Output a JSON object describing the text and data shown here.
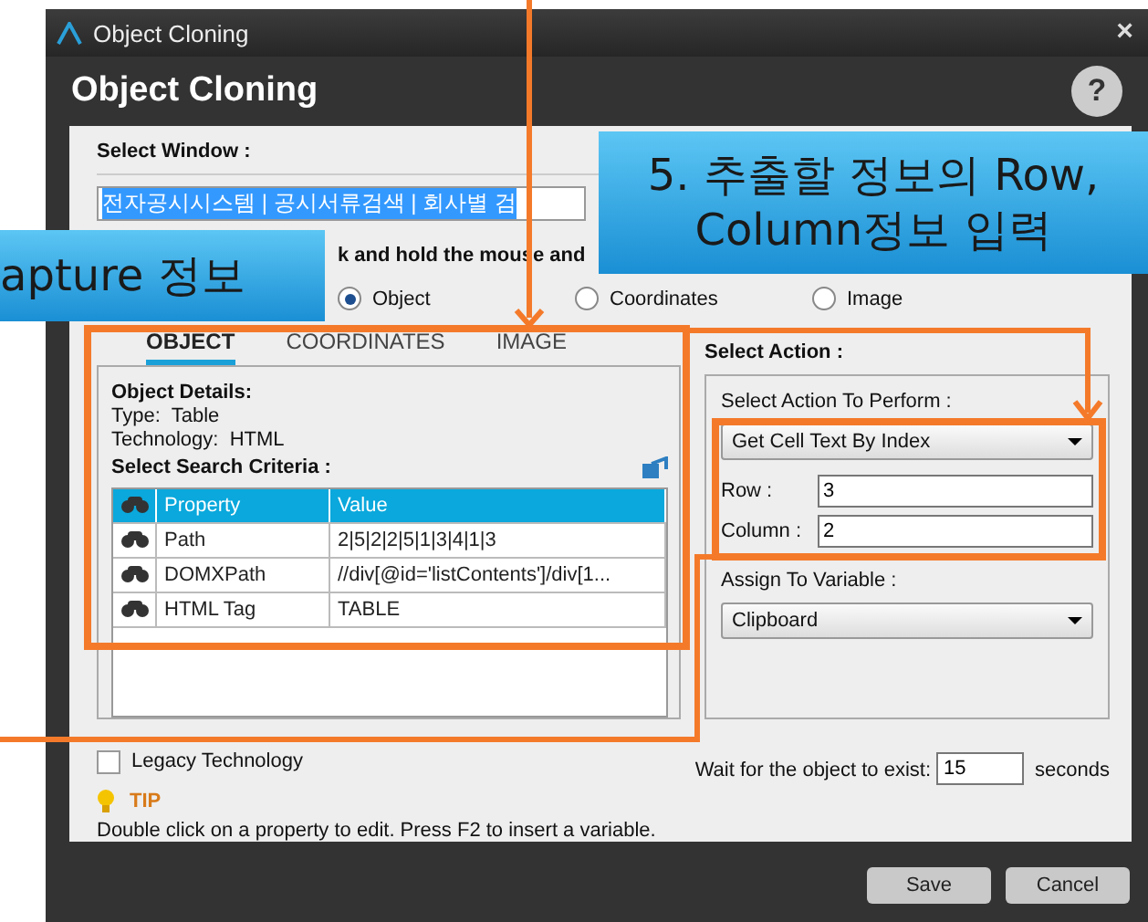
{
  "window": {
    "title": "Object Cloning",
    "close": "×"
  },
  "header": {
    "title": "Object Cloning",
    "help": "?"
  },
  "select_window": {
    "label": "Select Window :",
    "value": "전자공시시스템 | 공시서류검색 | 회사별 검"
  },
  "instruction": "k and hold the mouse and",
  "capture_modes": [
    {
      "label": "Object",
      "selected": true
    },
    {
      "label": "Coordinates",
      "selected": false
    },
    {
      "label": "Image",
      "selected": false
    }
  ],
  "tabs": [
    {
      "label": "OBJECT",
      "selected": true
    },
    {
      "label": "COORDINATES",
      "selected": false
    },
    {
      "label": "IMAGE",
      "selected": false
    }
  ],
  "object_details": {
    "heading": "Object Details:",
    "type_label": "Type:",
    "type": "Table",
    "technology_label": "Technology:",
    "technology": "HTML"
  },
  "search_criteria": {
    "heading": "Select Search Criteria :",
    "columns": [
      "Property",
      "Value"
    ],
    "rows": [
      {
        "property": "Path",
        "value": "2|5|2|2|5|1|3|4|1|3"
      },
      {
        "property": "DOMXPath",
        "value": "//div[@id='listContents']/div[1..."
      },
      {
        "property": "HTML Tag",
        "value": "TABLE"
      }
    ]
  },
  "action": {
    "heading": "Select Action :",
    "perform_label": "Select Action To Perform :",
    "perform_value": "Get Cell Text By Index",
    "row_label": "Row :",
    "row": "3",
    "column_label": "Column :",
    "column": "2",
    "assign_label": "Assign To Variable :",
    "assign_value": "Clipboard"
  },
  "legacy": {
    "label": "Legacy Technology",
    "checked": false
  },
  "wait": {
    "label": "Wait for the object to exist:",
    "value": "15",
    "unit": "seconds"
  },
  "tip": {
    "title": "TIP",
    "text": "Double click on a property to edit. Press F2 to insert a variable."
  },
  "buttons": [
    "Save",
    "Cancel"
  ],
  "annotations": [
    {
      "kind": "callout",
      "text": "apture 정보"
    },
    {
      "kind": "callout",
      "text": "5. 추출할 정보의 Row,\nColumn정보 입력"
    }
  ]
}
